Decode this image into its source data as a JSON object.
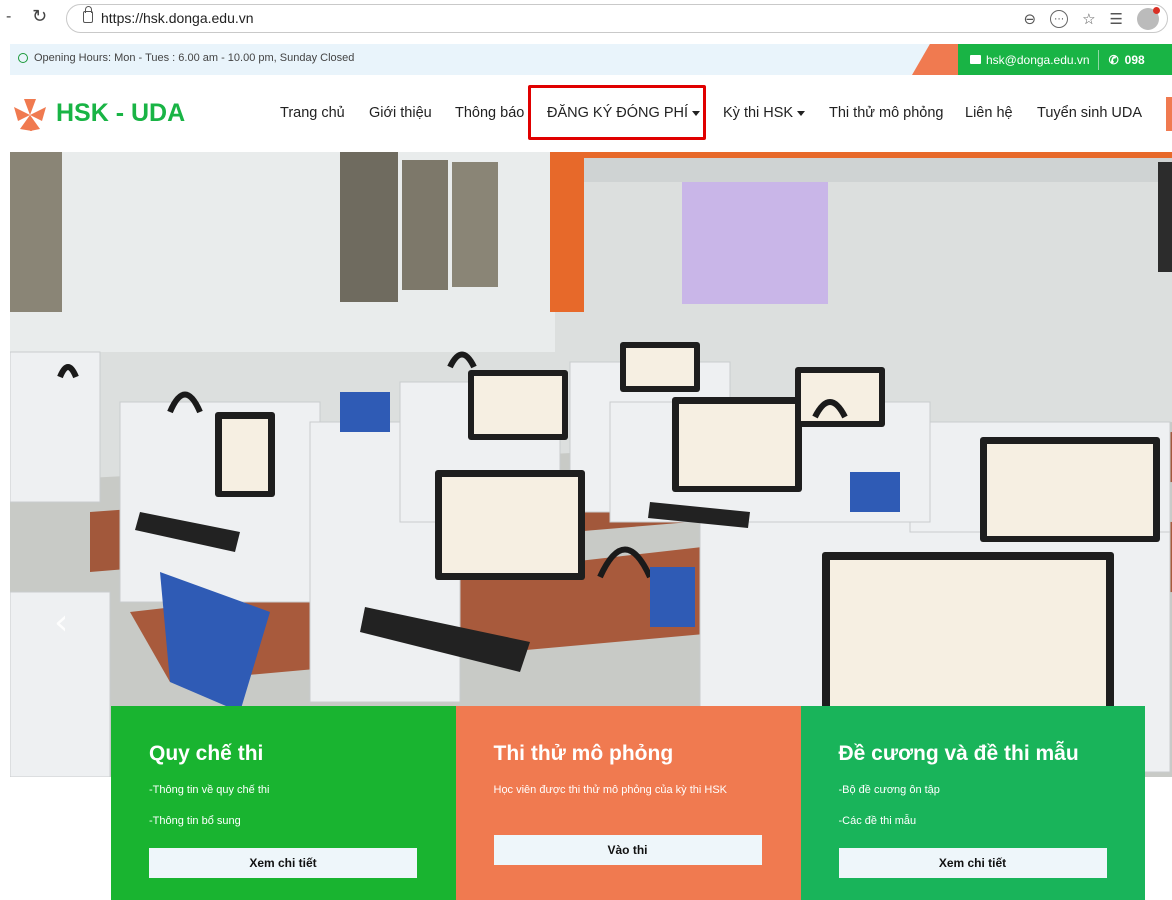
{
  "browser": {
    "dash": "-",
    "reload_icon": "reload-icon",
    "url": "https://hsk.donga.edu.vn"
  },
  "top_strip": {
    "hours": "Opening Hours: Mon - Tues : 6.00 am - 10.00 pm, Sunday Closed",
    "email": "hsk@donga.edu.vn",
    "phone": "098",
    "accent_green": "#19b445",
    "accent_orange": "#f07a50"
  },
  "nav": {
    "logo_text": "HSK - UDA",
    "items": [
      {
        "label": "Trang chủ"
      },
      {
        "label": "Giới thiệu"
      },
      {
        "label": "Thông báo"
      },
      {
        "label": "ĐĂNG KÝ ĐÓNG PHÍ",
        "dropdown": true,
        "highlighted": true
      },
      {
        "label": "Kỳ thi HSK",
        "dropdown": true
      },
      {
        "label": "Thi thử mô phỏng"
      },
      {
        "label": "Liên hệ"
      },
      {
        "label": "Tuyển sinh UDA"
      }
    ]
  },
  "cards": [
    {
      "title": "Quy chế thi",
      "lines": [
        "-Thông tin về quy chế thi",
        "-Thông tin bổ sung"
      ],
      "button": "Xem chi tiết",
      "color": "#19b430"
    },
    {
      "title": "Thi thử mô phỏng",
      "lines": [
        "Học viên được thi thử mô phỏng của kỳ thi HSK"
      ],
      "button": "Vào thi",
      "color": "#f07a50"
    },
    {
      "title": "Đề cương và đề thi mẫu",
      "lines": [
        "-Bộ đề cương ôn tập",
        "-Các đề thi mẫu"
      ],
      "button": "Xem chi tiết",
      "color": "#19b45a"
    }
  ]
}
